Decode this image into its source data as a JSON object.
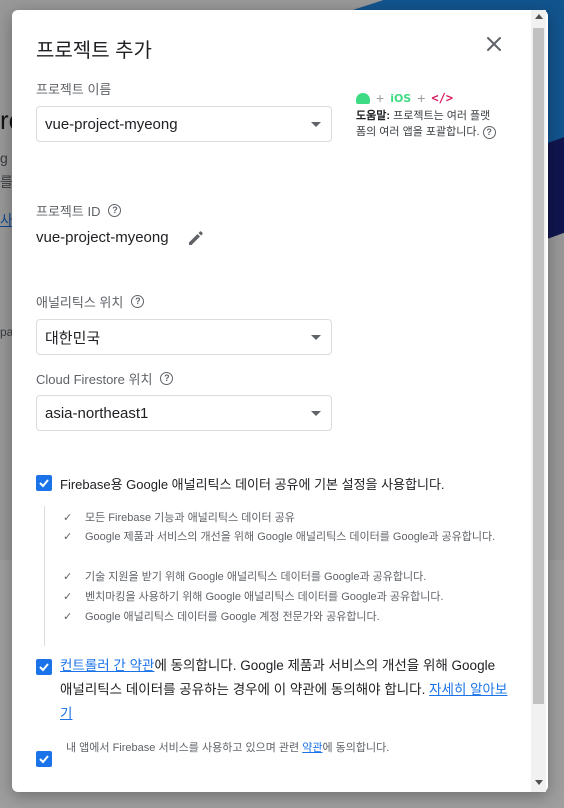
{
  "background": {
    "heading_fragment": "re",
    "text_fragment_1": "g",
    "text_fragment_2": "를",
    "link_fragment": "사",
    "text_fragment_3": "pa"
  },
  "dialog": {
    "title": "프로젝트 추가",
    "close_icon": "close-icon"
  },
  "project_name": {
    "label": "프로젝트 이름",
    "value": "vue-project-myeong"
  },
  "help": {
    "ios_label": "iOS",
    "code_label": "</>",
    "bold": "도움말:",
    "text": " 프로젝트는 여러 플랫폼의 여러 앱을 포괄합니다."
  },
  "project_id": {
    "label": "프로젝트 ID",
    "value": "vue-project-myeong"
  },
  "analytics_location": {
    "label": "애널리틱스 위치",
    "value": "대한민국"
  },
  "firestore_location": {
    "label": "Cloud Firestore 위치",
    "value": "asia-northeast1"
  },
  "sharing": {
    "main_label": "Firebase용 Google 애널리틱스 데이터 공유에 기본 설정을 사용합니다.",
    "items": [
      "모든 Firebase 기능과 애널리틱스 데이터 공유",
      "Google 제품과 서비스의 개선을 위해 Google 애널리틱스 데이터를 Google과 공유합니다.",
      "기술 지원을 받기 위해 Google 애널리틱스 데이터를 Google과 공유합니다.",
      "벤치마킹을 사용하기 위해 Google 애널리틱스 데이터를 Google과 공유합니다.",
      "Google 애널리틱스 데이터를 Google 계정 전문가와 공유합니다."
    ]
  },
  "terms": {
    "link_controller": "컨트롤러 간 약관",
    "text_1": "에 동의합니다. Google 제품과 서비스의 개선을 위해 Google 애널리틱스 데이터를 공유하는 경우에 이 약관에 동의해야 합니다. ",
    "link_more": "자세히 알아보기"
  },
  "final_consent": {
    "text_1": "내 앱에서 Firebase 서비스를 사용하고 있으며 관련 ",
    "link": "약관",
    "text_2": "에 동의합니다."
  },
  "colors": {
    "accent": "#1a73e8",
    "android_green": "#3ddc84",
    "code_pink": "#d81b60"
  }
}
